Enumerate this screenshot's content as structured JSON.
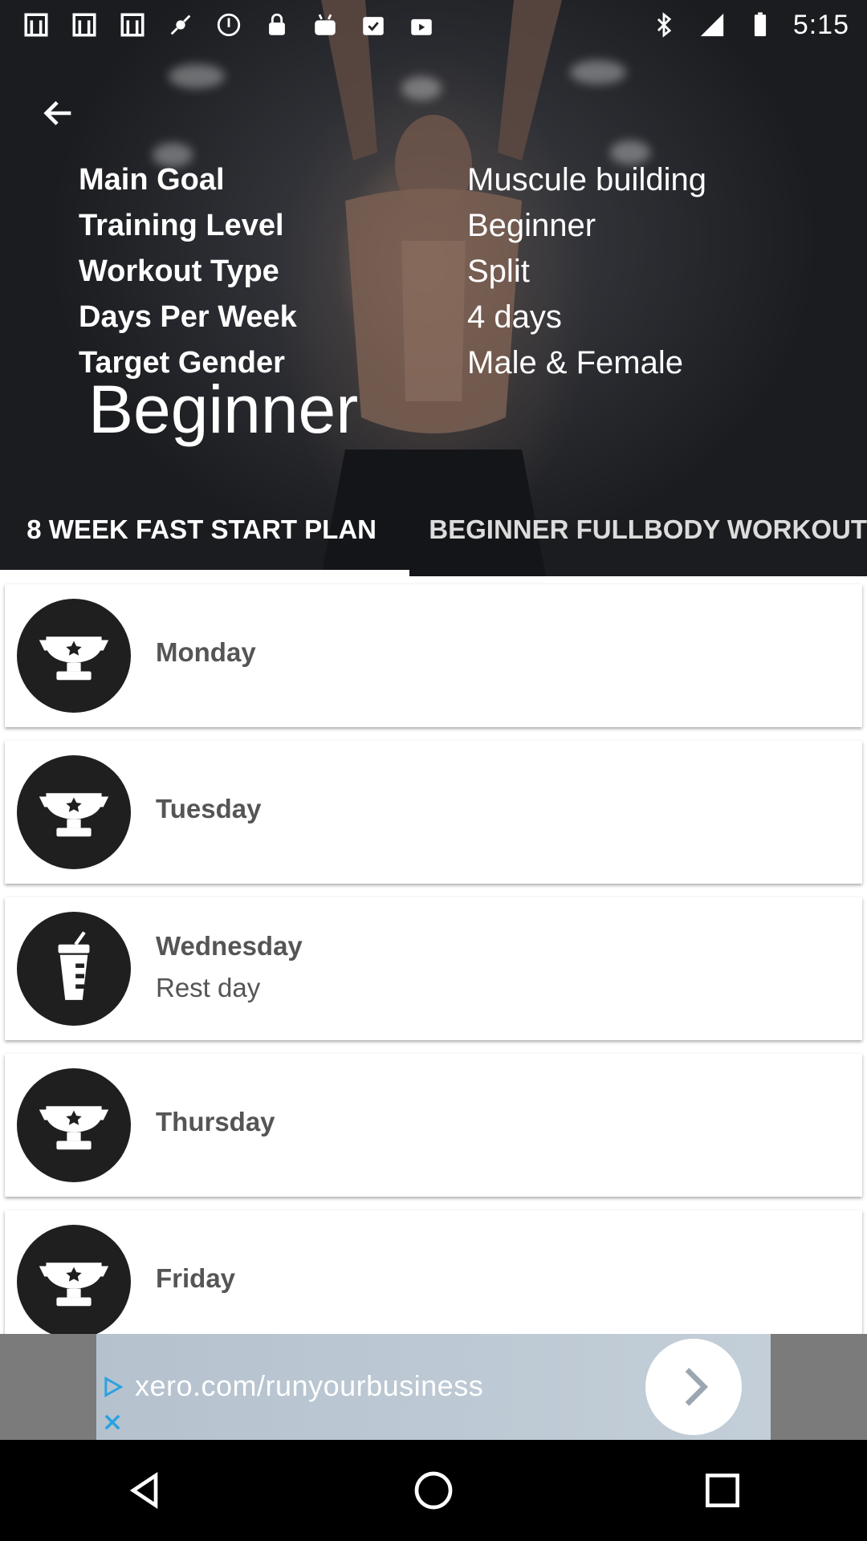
{
  "status_bar": {
    "time": "5:15",
    "left_icons": [
      "app-icon",
      "app-icon",
      "app-icon",
      "fake-gps-icon",
      "sync-icon",
      "lock-icon",
      "android-icon",
      "checklist-icon",
      "bag-icon"
    ],
    "right_icons": [
      "bluetooth-icon",
      "signal-icon",
      "battery-icon"
    ]
  },
  "hero": {
    "details": [
      {
        "label": "Main Goal",
        "value": "Muscule building"
      },
      {
        "label": "Training Level",
        "value": "Beginner"
      },
      {
        "label": "Workout Type",
        "value": "Split"
      },
      {
        "label": "Days Per Week",
        "value": "4 days"
      },
      {
        "label": "Target Gender",
        "value": "Male & Female"
      }
    ],
    "level_title": "Beginner",
    "tabs": [
      {
        "label": "8 WEEK FAST START PLAN",
        "selected": true
      },
      {
        "label": "BEGINNER FULLBODY WORKOUT",
        "selected": false
      }
    ]
  },
  "days": [
    {
      "name": "Monday",
      "subtitle": "",
      "icon": "trophy-icon"
    },
    {
      "name": "Tuesday",
      "subtitle": "",
      "icon": "trophy-icon"
    },
    {
      "name": "Wednesday",
      "subtitle": "Rest day",
      "icon": "drink-cup-icon"
    },
    {
      "name": "Thursday",
      "subtitle": "",
      "icon": "trophy-icon"
    },
    {
      "name": "Friday",
      "subtitle": "",
      "icon": "trophy-icon"
    }
  ],
  "ad": {
    "url": "xero.com/runyourbusiness"
  },
  "colors": {
    "card_text": "#555555",
    "icon_bg": "#1f1f1f",
    "ad_bg": "#b5c2ce"
  }
}
